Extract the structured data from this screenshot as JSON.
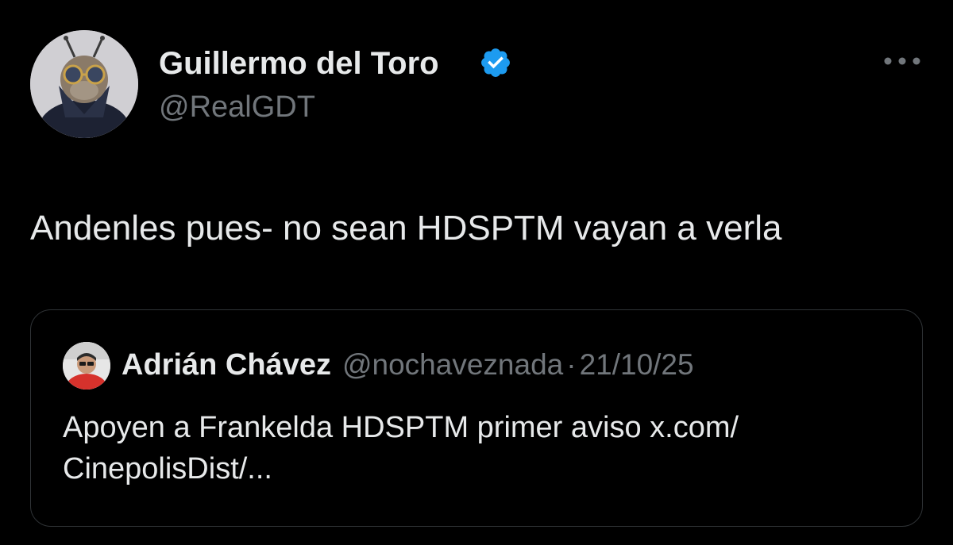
{
  "tweet": {
    "author": {
      "name": "Guillermo del Toro",
      "handle": "@RealGDT",
      "verified": true,
      "avatar_icon": "user-avatar-icon"
    },
    "text": "Andenles pues- no sean HDSPTM vayan a verla",
    "more_icon": "more-horizontal-icon",
    "quote": {
      "author": {
        "name": "Adrián Chávez",
        "handle": "@nochaveznada",
        "avatar_icon": "user-avatar-icon"
      },
      "separator": "·",
      "date": "21/10/25",
      "text_line1": "Apoyen a Frankelda HDSPTM primer aviso x.com/",
      "text_line2": "CinepolisDist/..."
    }
  },
  "colors": {
    "background": "#000000",
    "primary_text": "#e7e9ea",
    "secondary_text": "#71767b",
    "border": "#2f3336",
    "verified_badge": "#1d9bf0"
  }
}
